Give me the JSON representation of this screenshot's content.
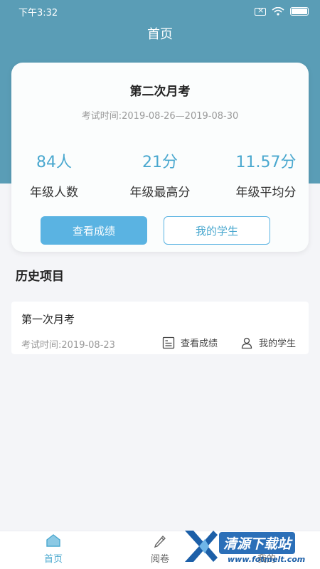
{
  "status_bar": {
    "time": "下午3:32"
  },
  "header": {
    "title": "首页"
  },
  "current_exam": {
    "title": "第二次月考",
    "date": "考试时间:2019-08-26—2019-08-30",
    "stats": [
      {
        "value": "84人",
        "label": "年级人数"
      },
      {
        "value": "21分",
        "label": "年级最高分"
      },
      {
        "value": "11.57分",
        "label": "年级平均分"
      }
    ],
    "view_scores_label": "查看成绩",
    "my_students_label": "我的学生"
  },
  "history": {
    "title": "历史项目",
    "items": [
      {
        "name": "第一次月考",
        "date": "考试时间:2019-08-23",
        "view_scores_label": "查看成绩",
        "my_students_label": "我的学生"
      }
    ]
  },
  "tabbar": {
    "tabs": [
      {
        "label": "首页",
        "icon": "home-icon",
        "active": true
      },
      {
        "label": "阅卷",
        "icon": "pencil-icon",
        "active": false
      },
      {
        "label": "我的",
        "icon": "user-icon",
        "active": false
      }
    ]
  },
  "watermark": {
    "text": "清源下载站",
    "sub": "www.fotmelt.com"
  },
  "colors": {
    "accent": "#5ab3e2",
    "header_bg": "#5a9db6",
    "stat_value": "#4aa8cf"
  }
}
